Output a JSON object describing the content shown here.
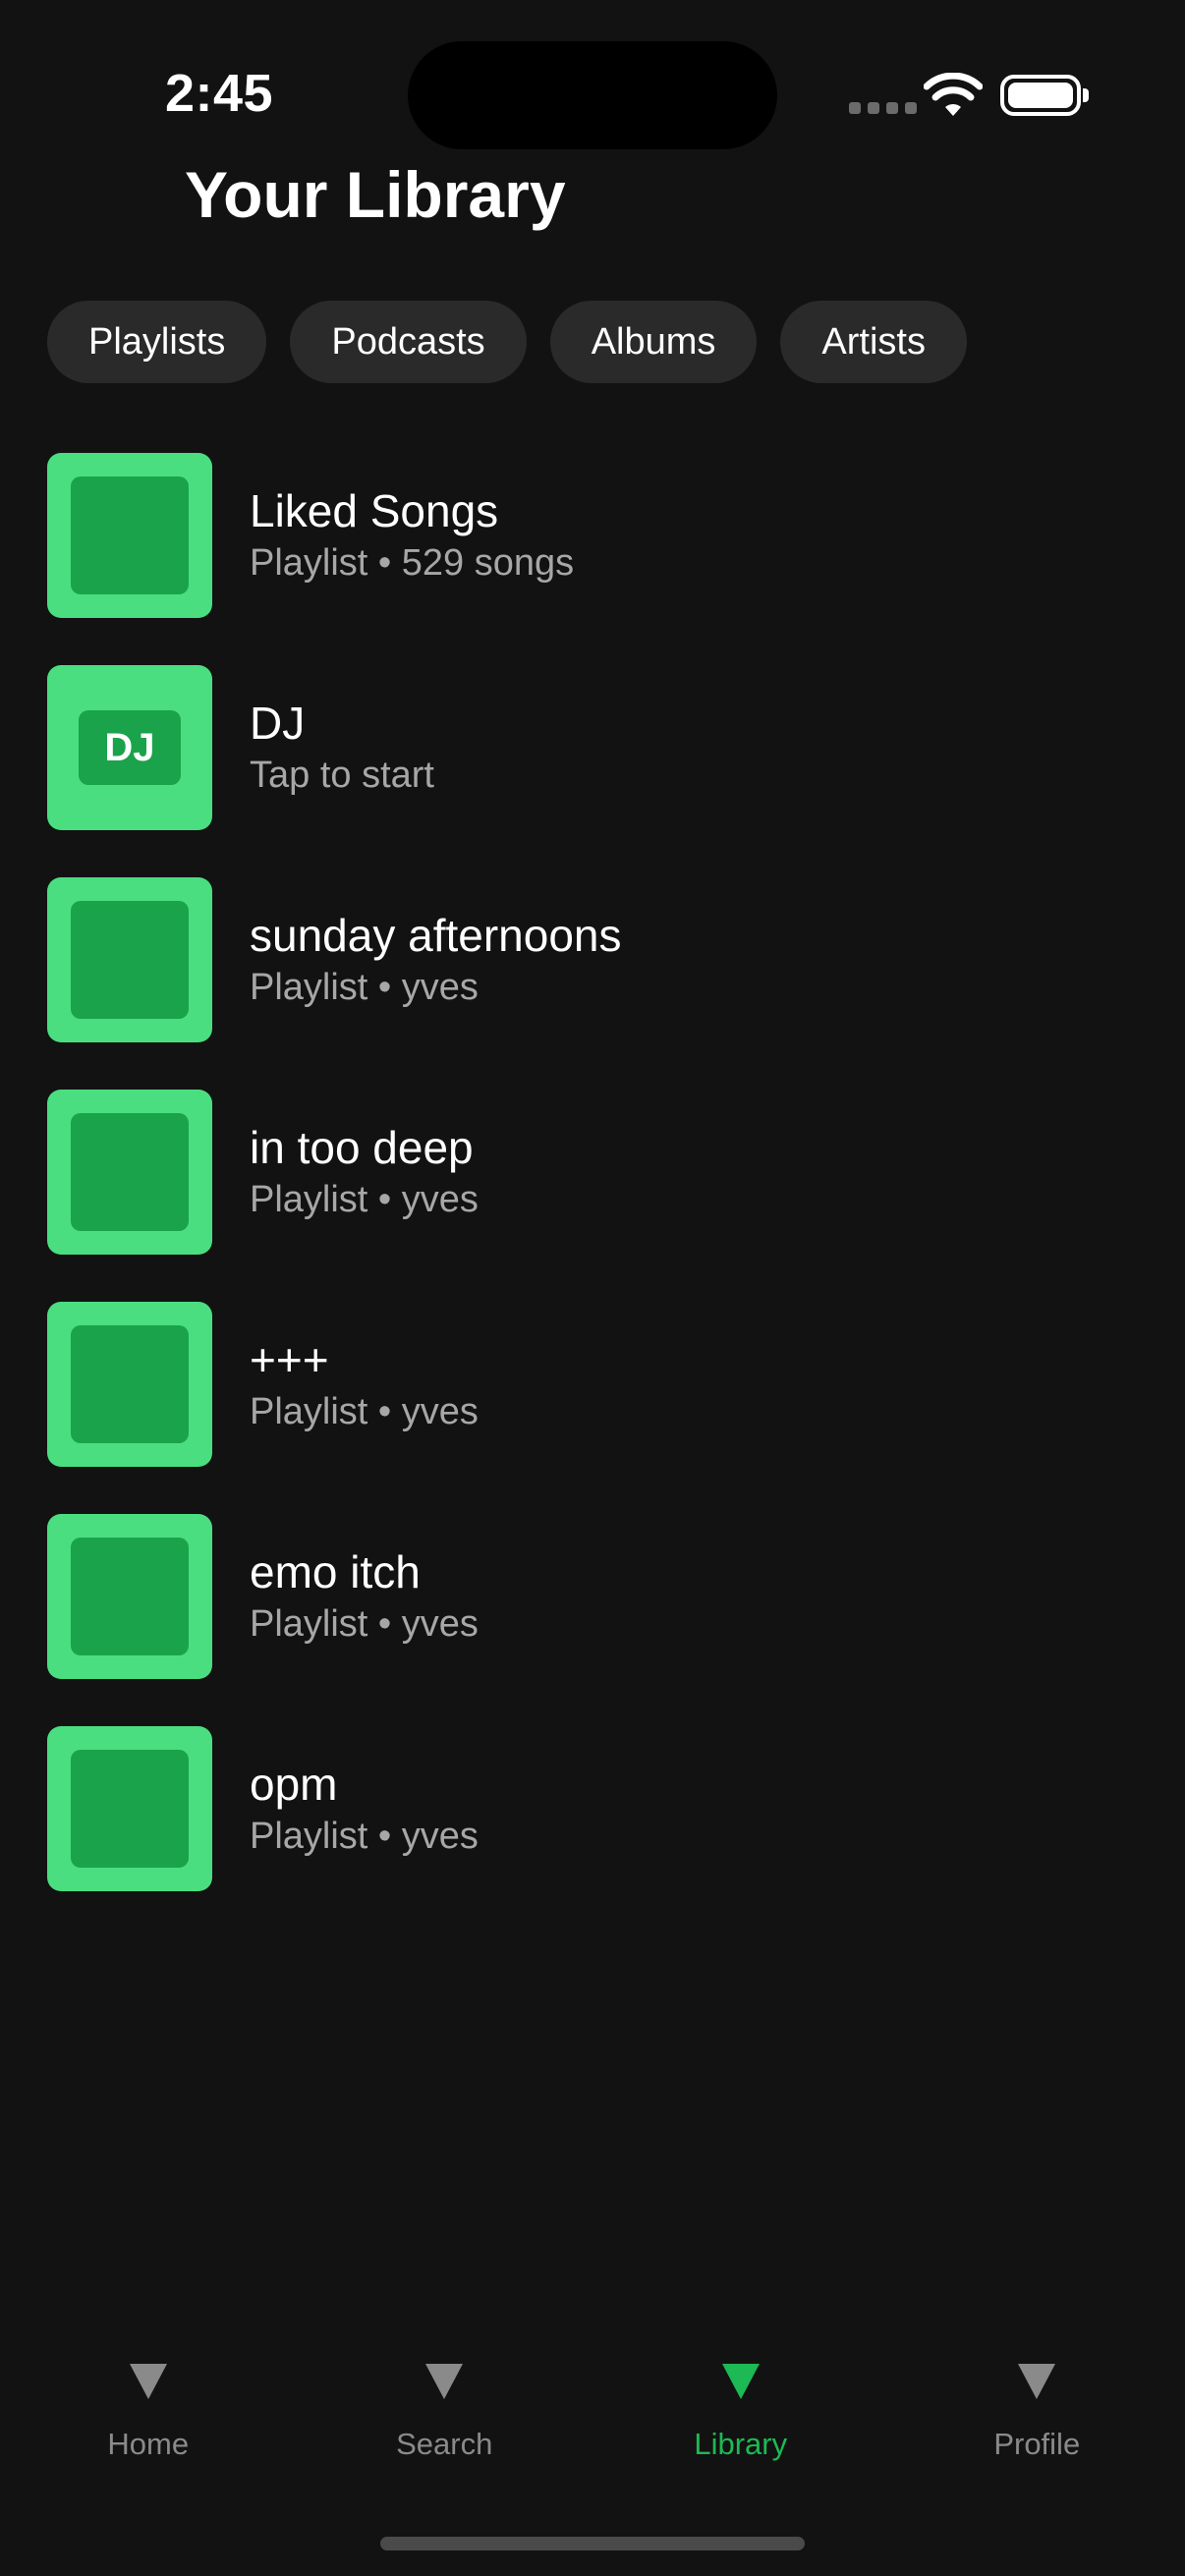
{
  "status_bar": {
    "time": "2:45",
    "icons": [
      "signal-icon",
      "wifi-icon",
      "battery-icon"
    ]
  },
  "header": {
    "title": "Your Library"
  },
  "filters": [
    {
      "label": "Playlists"
    },
    {
      "label": "Podcasts"
    },
    {
      "label": "Albums"
    },
    {
      "label": "Artists"
    }
  ],
  "library": {
    "items": [
      {
        "title": "Liked Songs",
        "subtitle": "Playlist • 529 songs"
      },
      {
        "title": "DJ",
        "subtitle": "Tap to start",
        "cover_text": "DJ"
      },
      {
        "title": "sunday afternoons",
        "subtitle": "Playlist • yves"
      },
      {
        "title": "in too deep",
        "subtitle": "Playlist • yves"
      },
      {
        "title": "+++",
        "subtitle": "Playlist • yves"
      },
      {
        "title": "emo itch",
        "subtitle": "Playlist • yves"
      },
      {
        "title": "opm",
        "subtitle": "Playlist • yves"
      }
    ]
  },
  "tab_bar": {
    "tabs": [
      {
        "label": "Home",
        "active": false
      },
      {
        "label": "Search",
        "active": false
      },
      {
        "label": "Library",
        "active": true
      },
      {
        "label": "Profile",
        "active": false
      }
    ]
  },
  "colors": {
    "background": "#121212",
    "accent": "#1db954",
    "cover_light": "#4ade80",
    "cover_dark": "#1aa34a",
    "chip_bg": "#2a2a2a",
    "muted_text": "#a7a7a7"
  }
}
